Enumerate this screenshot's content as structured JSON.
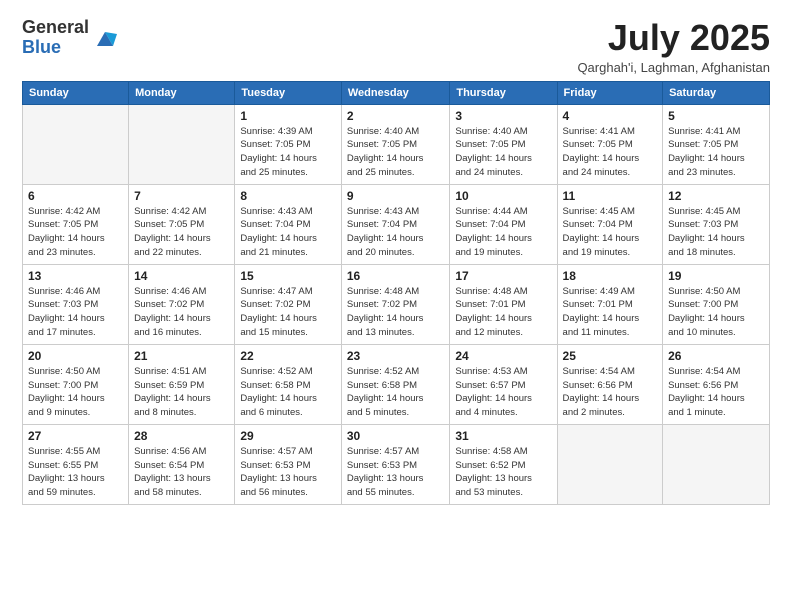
{
  "logo": {
    "general": "General",
    "blue": "Blue"
  },
  "header": {
    "month": "July 2025",
    "location": "Qarghah'i, Laghman, Afghanistan"
  },
  "weekdays": [
    "Sunday",
    "Monday",
    "Tuesday",
    "Wednesday",
    "Thursday",
    "Friday",
    "Saturday"
  ],
  "weeks": [
    [
      {
        "day": "",
        "detail": ""
      },
      {
        "day": "",
        "detail": ""
      },
      {
        "day": "1",
        "detail": "Sunrise: 4:39 AM\nSunset: 7:05 PM\nDaylight: 14 hours\nand 25 minutes."
      },
      {
        "day": "2",
        "detail": "Sunrise: 4:40 AM\nSunset: 7:05 PM\nDaylight: 14 hours\nand 25 minutes."
      },
      {
        "day": "3",
        "detail": "Sunrise: 4:40 AM\nSunset: 7:05 PM\nDaylight: 14 hours\nand 24 minutes."
      },
      {
        "day": "4",
        "detail": "Sunrise: 4:41 AM\nSunset: 7:05 PM\nDaylight: 14 hours\nand 24 minutes."
      },
      {
        "day": "5",
        "detail": "Sunrise: 4:41 AM\nSunset: 7:05 PM\nDaylight: 14 hours\nand 23 minutes."
      }
    ],
    [
      {
        "day": "6",
        "detail": "Sunrise: 4:42 AM\nSunset: 7:05 PM\nDaylight: 14 hours\nand 23 minutes."
      },
      {
        "day": "7",
        "detail": "Sunrise: 4:42 AM\nSunset: 7:05 PM\nDaylight: 14 hours\nand 22 minutes."
      },
      {
        "day": "8",
        "detail": "Sunrise: 4:43 AM\nSunset: 7:04 PM\nDaylight: 14 hours\nand 21 minutes."
      },
      {
        "day": "9",
        "detail": "Sunrise: 4:43 AM\nSunset: 7:04 PM\nDaylight: 14 hours\nand 20 minutes."
      },
      {
        "day": "10",
        "detail": "Sunrise: 4:44 AM\nSunset: 7:04 PM\nDaylight: 14 hours\nand 19 minutes."
      },
      {
        "day": "11",
        "detail": "Sunrise: 4:45 AM\nSunset: 7:04 PM\nDaylight: 14 hours\nand 19 minutes."
      },
      {
        "day": "12",
        "detail": "Sunrise: 4:45 AM\nSunset: 7:03 PM\nDaylight: 14 hours\nand 18 minutes."
      }
    ],
    [
      {
        "day": "13",
        "detail": "Sunrise: 4:46 AM\nSunset: 7:03 PM\nDaylight: 14 hours\nand 17 minutes."
      },
      {
        "day": "14",
        "detail": "Sunrise: 4:46 AM\nSunset: 7:02 PM\nDaylight: 14 hours\nand 16 minutes."
      },
      {
        "day": "15",
        "detail": "Sunrise: 4:47 AM\nSunset: 7:02 PM\nDaylight: 14 hours\nand 15 minutes."
      },
      {
        "day": "16",
        "detail": "Sunrise: 4:48 AM\nSunset: 7:02 PM\nDaylight: 14 hours\nand 13 minutes."
      },
      {
        "day": "17",
        "detail": "Sunrise: 4:48 AM\nSunset: 7:01 PM\nDaylight: 14 hours\nand 12 minutes."
      },
      {
        "day": "18",
        "detail": "Sunrise: 4:49 AM\nSunset: 7:01 PM\nDaylight: 14 hours\nand 11 minutes."
      },
      {
        "day": "19",
        "detail": "Sunrise: 4:50 AM\nSunset: 7:00 PM\nDaylight: 14 hours\nand 10 minutes."
      }
    ],
    [
      {
        "day": "20",
        "detail": "Sunrise: 4:50 AM\nSunset: 7:00 PM\nDaylight: 14 hours\nand 9 minutes."
      },
      {
        "day": "21",
        "detail": "Sunrise: 4:51 AM\nSunset: 6:59 PM\nDaylight: 14 hours\nand 8 minutes."
      },
      {
        "day": "22",
        "detail": "Sunrise: 4:52 AM\nSunset: 6:58 PM\nDaylight: 14 hours\nand 6 minutes."
      },
      {
        "day": "23",
        "detail": "Sunrise: 4:52 AM\nSunset: 6:58 PM\nDaylight: 14 hours\nand 5 minutes."
      },
      {
        "day": "24",
        "detail": "Sunrise: 4:53 AM\nSunset: 6:57 PM\nDaylight: 14 hours\nand 4 minutes."
      },
      {
        "day": "25",
        "detail": "Sunrise: 4:54 AM\nSunset: 6:56 PM\nDaylight: 14 hours\nand 2 minutes."
      },
      {
        "day": "26",
        "detail": "Sunrise: 4:54 AM\nSunset: 6:56 PM\nDaylight: 14 hours\nand 1 minute."
      }
    ],
    [
      {
        "day": "27",
        "detail": "Sunrise: 4:55 AM\nSunset: 6:55 PM\nDaylight: 13 hours\nand 59 minutes."
      },
      {
        "day": "28",
        "detail": "Sunrise: 4:56 AM\nSunset: 6:54 PM\nDaylight: 13 hours\nand 58 minutes."
      },
      {
        "day": "29",
        "detail": "Sunrise: 4:57 AM\nSunset: 6:53 PM\nDaylight: 13 hours\nand 56 minutes."
      },
      {
        "day": "30",
        "detail": "Sunrise: 4:57 AM\nSunset: 6:53 PM\nDaylight: 13 hours\nand 55 minutes."
      },
      {
        "day": "31",
        "detail": "Sunrise: 4:58 AM\nSunset: 6:52 PM\nDaylight: 13 hours\nand 53 minutes."
      },
      {
        "day": "",
        "detail": ""
      },
      {
        "day": "",
        "detail": ""
      }
    ]
  ]
}
